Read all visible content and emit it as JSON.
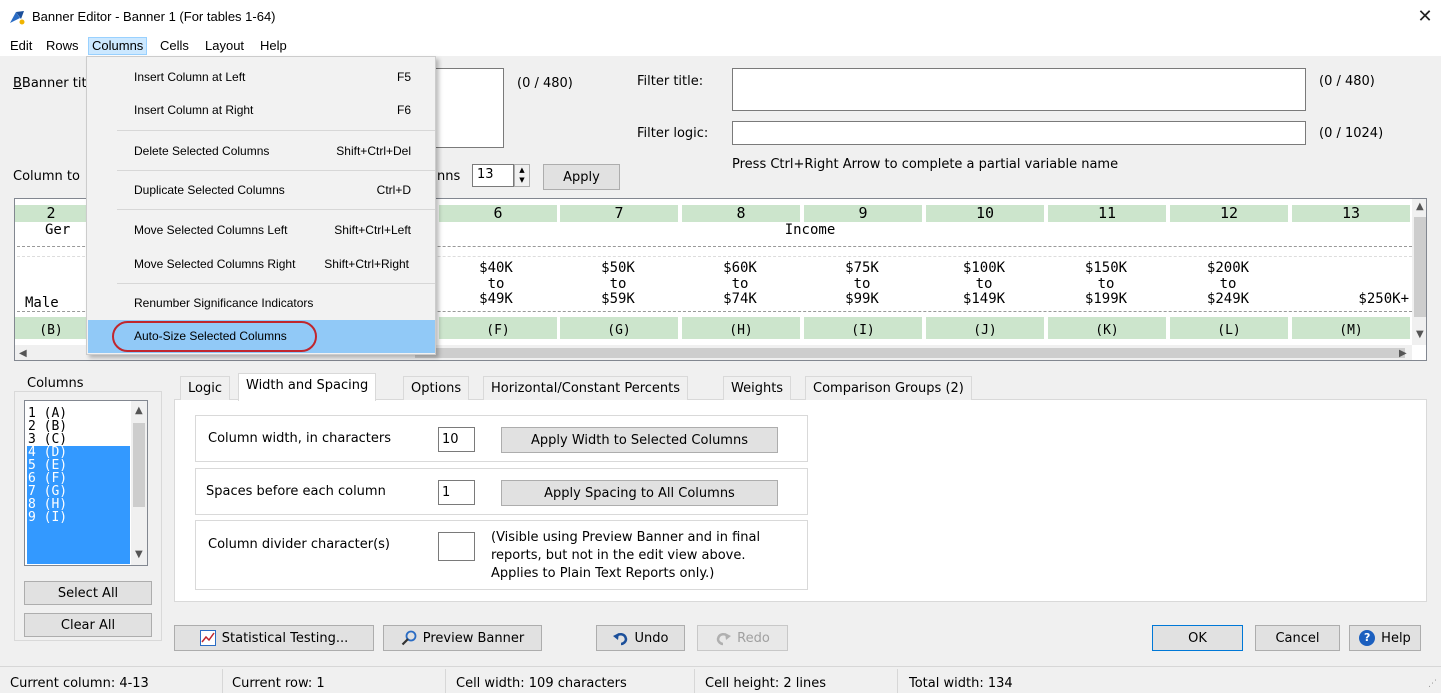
{
  "window": {
    "title": "Banner Editor - Banner 1 (For tables 1-64)",
    "close": "✕"
  },
  "menubar": [
    "Edit",
    "Rows",
    "Columns",
    "Cells",
    "Layout",
    "Help"
  ],
  "dropdown": {
    "items": [
      {
        "label": "Insert Column at Left",
        "shortcut": "F5"
      },
      {
        "label": "Insert Column at Right",
        "shortcut": "F6"
      },
      {
        "label": "Delete Selected Columns",
        "shortcut": "Shift+Ctrl+Del"
      },
      {
        "label": "Duplicate Selected Columns",
        "shortcut": "Ctrl+D"
      },
      {
        "label": "Move Selected Columns Left",
        "shortcut": "Shift+Ctrl+Left"
      },
      {
        "label": "Move Selected Columns Right",
        "shortcut": "Shift+Ctrl+Right"
      },
      {
        "label": "Renumber Significance Indicators",
        "shortcut": ""
      },
      {
        "label": "Auto-Size Selected Columns",
        "shortcut": ""
      }
    ]
  },
  "form": {
    "banner_title_label": "Banner tit",
    "banner_title_count": "(0 / 480)",
    "filter_title_label": "Filter title:",
    "filter_title_count": "(0 / 480)",
    "filter_logic_label": "Filter logic:",
    "filter_logic_count": "(0 / 1024)",
    "hint": "Press Ctrl+Right Arrow to complete a partial variable name",
    "column_to_label": "Column to",
    "columns_label": "nns",
    "columns_value": "13",
    "apply": "Apply"
  },
  "grid": {
    "col_numbers": [
      "2",
      "6",
      "7",
      "8",
      "9",
      "10",
      "11",
      "12",
      "13"
    ],
    "header_partial": "Ger",
    "group_label": "Income",
    "male": "Male",
    "ranges": [
      {
        "top": "$40K",
        "mid": "to",
        "bot": "$49K"
      },
      {
        "top": "$50K",
        "mid": "to",
        "bot": "$59K"
      },
      {
        "top": "$60K",
        "mid": "to",
        "bot": "$74K"
      },
      {
        "top": "$75K",
        "mid": "to",
        "bot": "$99K"
      },
      {
        "top": "$100K",
        "mid": "to",
        "bot": "$149K"
      },
      {
        "top": "$150K",
        "mid": "to",
        "bot": "$199K"
      },
      {
        "top": "$200K",
        "mid": "to",
        "bot": "$249K"
      },
      {
        "top": "",
        "mid": "",
        "bot": "$250K+"
      }
    ],
    "sig_first": "(B)",
    "sig": [
      "(F)",
      "(G)",
      "(H)",
      "(I)",
      "(J)",
      "(K)",
      "(L)",
      "(M)"
    ]
  },
  "columns_panel": {
    "title": "Columns",
    "items": [
      "1 (A)",
      "2 (B)",
      "3 (C)",
      "4 (D)",
      "5 (E)",
      "6 (F)",
      "7 (G)",
      "8 (H)",
      "9 (I)"
    ],
    "select_all": "Select All",
    "clear_all": "Clear All"
  },
  "tabs": [
    "Logic",
    "Width and Spacing",
    "Options",
    "Horizontal/Constant Percents",
    "Weights",
    "Comparison Groups (2)"
  ],
  "width_tab": {
    "col_width_label": "Column width, in characters",
    "col_width_value": "10",
    "apply_width": "Apply Width to Selected Columns",
    "spaces_label": "Spaces before each column",
    "spaces_value": "1",
    "apply_spacing": "Apply Spacing to All Columns",
    "divider_label": "Column divider character(s)",
    "divider_value": "",
    "divider_note_1": "(Visible using Preview Banner and in final",
    "divider_note_2": "reports, but not in the edit view above.",
    "divider_note_3": "Applies to Plain Text Reports only.)"
  },
  "bottom": {
    "stat_testing": "Statistical Testing...",
    "preview": "Preview Banner",
    "undo": "Undo",
    "redo": "Redo",
    "ok": "OK",
    "cancel": "Cancel",
    "help": "Help"
  },
  "status": {
    "current_column": "Current column: 4-13",
    "current_row": "Current row: 1",
    "cell_width": "Cell width: 109 characters",
    "cell_height": "Cell height: 2 lines",
    "total_width": "Total width: 134"
  },
  "colors": {
    "grid_green": "#cce5cc",
    "selection": "#3399ff",
    "menu_highlight": "#91c9f7",
    "annotation_red": "#c0262d"
  }
}
